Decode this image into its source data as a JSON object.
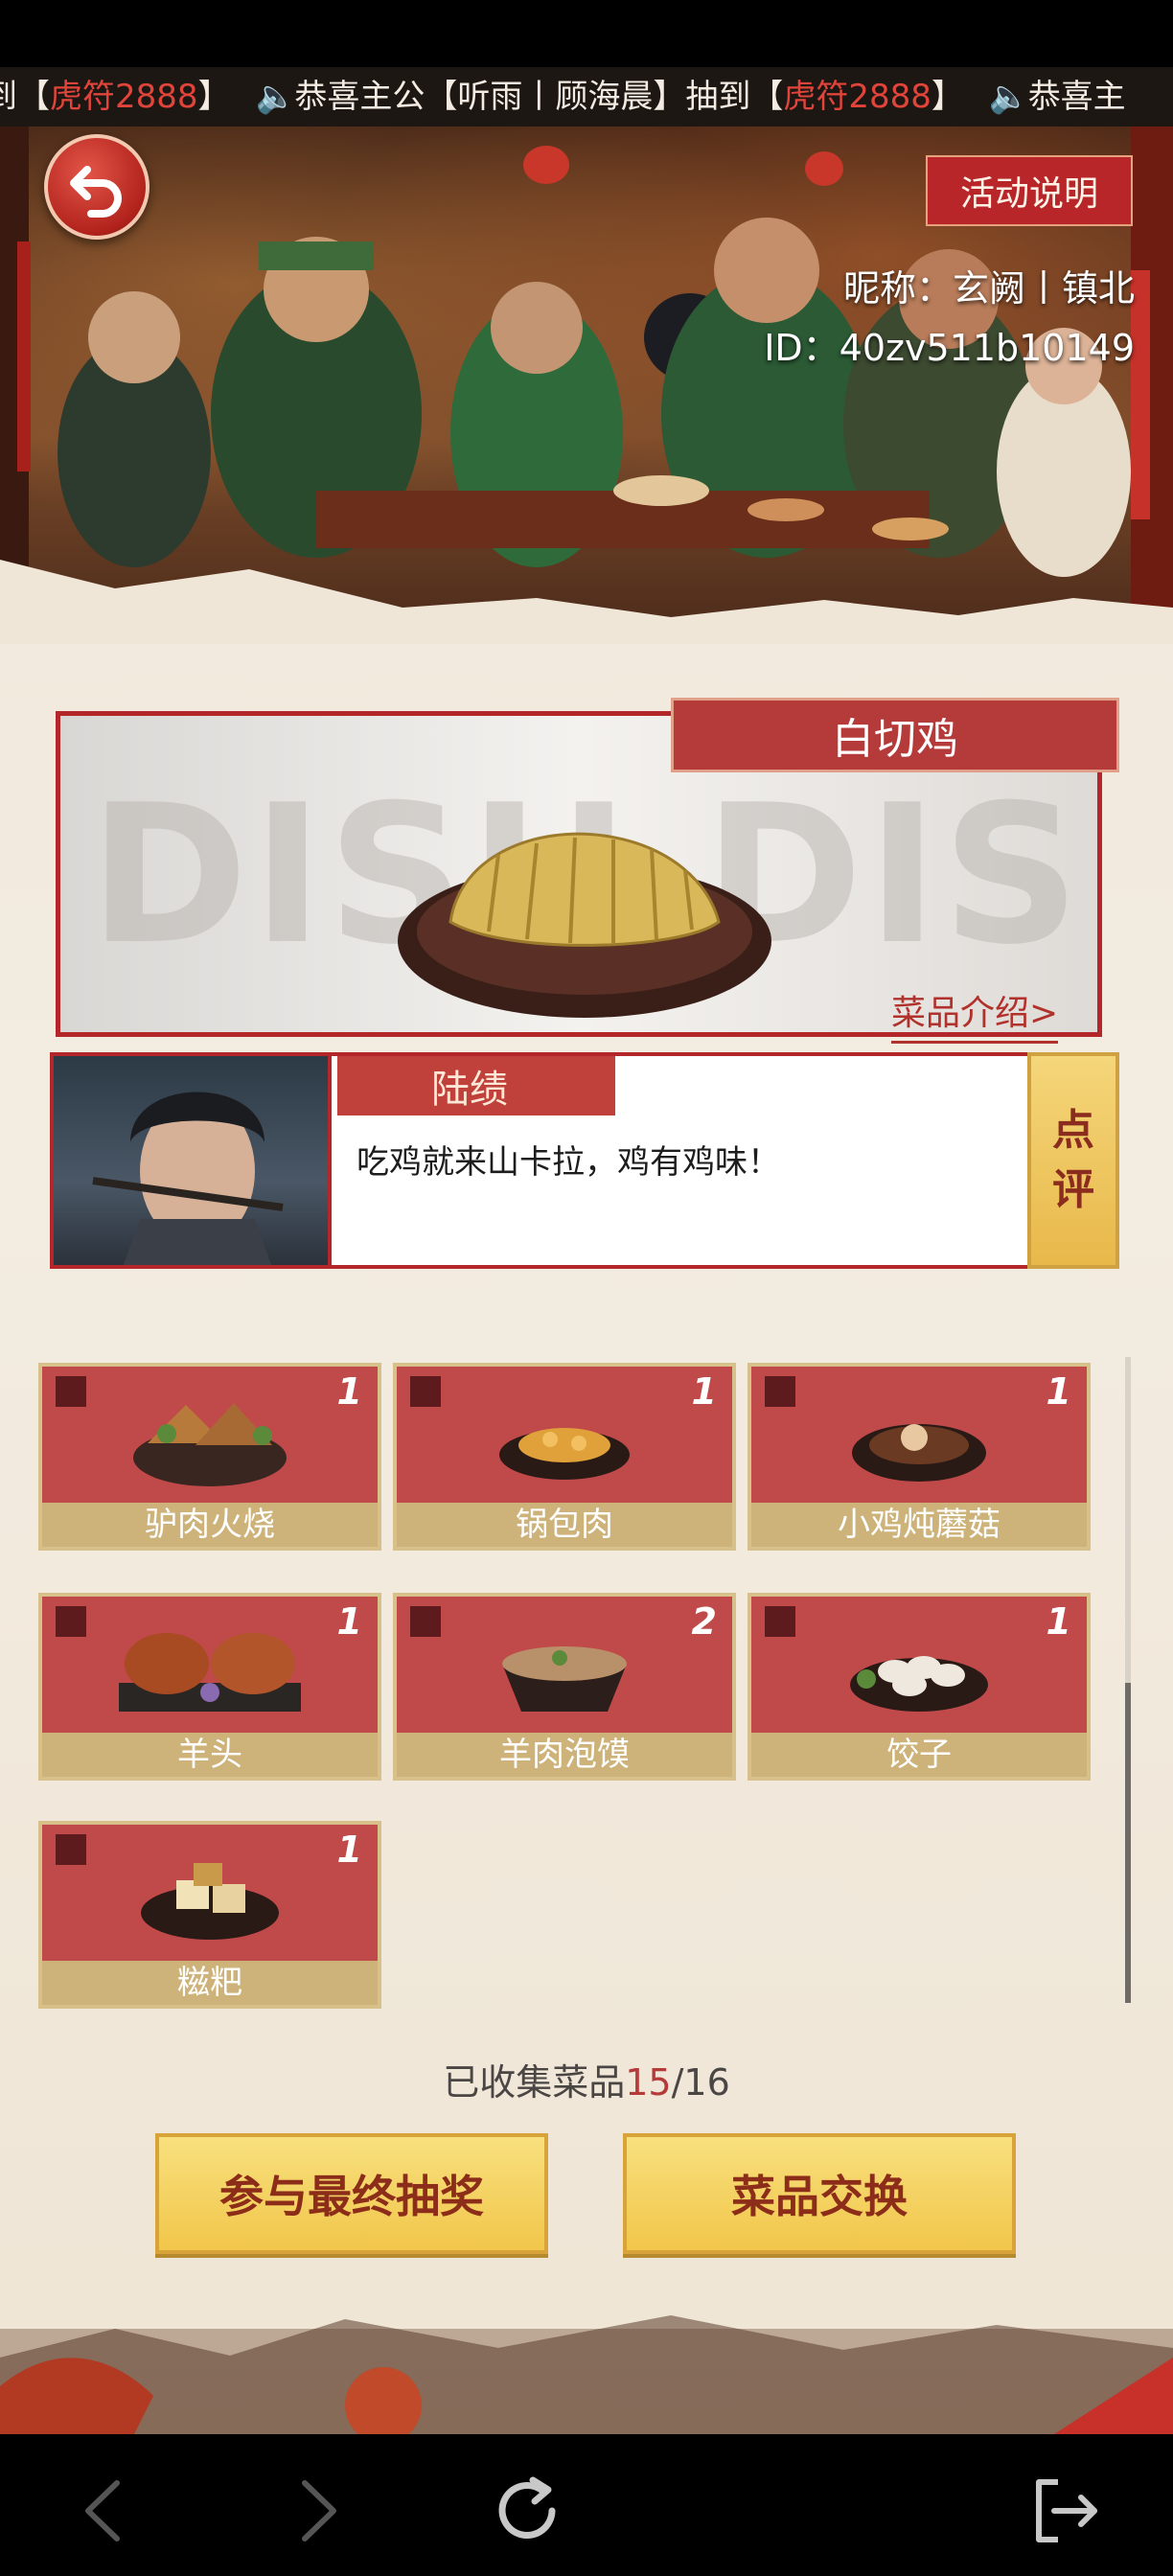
{
  "marquee": {
    "segments": [
      {
        "prefix": "到【",
        "prize": "虎符2888",
        "suffix": "】"
      },
      {
        "prefix": "恭喜主公【听雨丨顾海晨】抽到【",
        "prize": "虎符2888",
        "suffix": "】"
      },
      {
        "prefix": "恭喜主",
        "prize": "",
        "suffix": ""
      }
    ]
  },
  "header": {
    "back_label": "back",
    "rules_button": "活动说明",
    "nickname": "昵称：玄阙丨镇北",
    "user_id": "ID：40zv511b10149"
  },
  "dish_display": {
    "watermark": "DISH DISPLAY",
    "dish_name": "白切鸡",
    "intro_link": "菜品介绍>"
  },
  "quote": {
    "character_name": "陆绩",
    "text": "吃鸡就来山卡拉，鸡有鸡味！",
    "comment_button_top": "点",
    "comment_button_bottom": "评"
  },
  "dishes": [
    {
      "name": "驴肉火烧",
      "count": "1"
    },
    {
      "name": "锅包肉",
      "count": "1"
    },
    {
      "name": "小鸡炖蘑菇",
      "count": "1"
    },
    {
      "name": "羊头",
      "count": "1"
    },
    {
      "name": "羊肉泡馍",
      "count": "2"
    },
    {
      "name": "饺子",
      "count": "1"
    },
    {
      "name": "糍粑",
      "count": "1"
    }
  ],
  "collection": {
    "label": "已收集菜品",
    "collected": "15",
    "total": "/16"
  },
  "buttons": {
    "final_lottery": "参与最终抽奖",
    "dish_exchange": "菜品交换"
  },
  "colors": {
    "accent_red": "#b3262a",
    "gold": "#f1c64a",
    "highlight_red": "#e0443a"
  }
}
